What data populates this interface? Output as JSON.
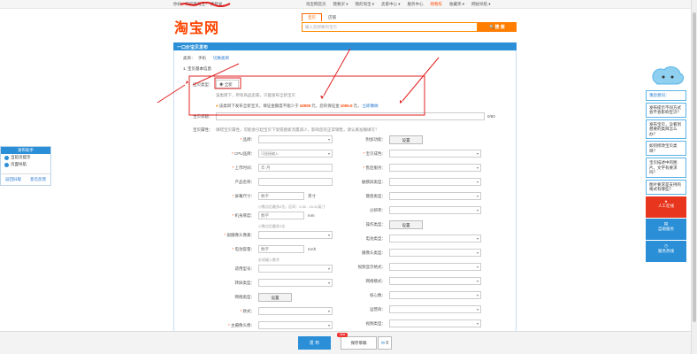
{
  "topnav": {
    "left": "你好，欢迎来淘宝！ 请登录",
    "user_links": "我的淘",
    "items": [
      "淘宝网首页",
      "我要买 ▾",
      "我的淘宝 ▾",
      "卖家中心 ▾",
      "服务中心",
      "购物车",
      "收藏夹 ▾",
      "网站导航 ▾"
    ]
  },
  "logo": "淘宝网",
  "search": {
    "tabs": [
      "宝贝",
      "店铺"
    ],
    "placeholder": "输入您想要的宝贝",
    "button": "搜 索"
  },
  "page_title": "一口价宝贝发布",
  "category": {
    "label": "类目：",
    "value": "手机",
    "change": "切换类目"
  },
  "section_title": "1. 宝贝基本信息",
  "item_type": {
    "label": "宝贝类型：",
    "option": "全新",
    "note": "该类目下，所有商品卖家，只能发布全新宝贝",
    "deposit_note": "该类目下发布全新宝贝，保证金额度不能少于",
    "amount": "10000",
    "unit": "元，您的保证金",
    "balance": "1000.0",
    "unit2": "元，",
    "link": "立即缴纳"
  },
  "title_field": {
    "label": "宝贝标题：",
    "counter": "0/60"
  },
  "props": {
    "label": "宝贝属性：",
    "hint": "填错宝贝属性，可能会引起宝贝下架或搜索流量减少，影响您的正常销售，请认真准确填写！",
    "left": [
      {
        "label": "品牌：",
        "type": "select",
        "value": "",
        "req": true
      },
      {
        "label": "CPU品牌：",
        "type": "select",
        "value": "可直接输入",
        "req": true
      },
      {
        "label": "上市时间：",
        "type": "input",
        "value": "年-月",
        "req": true
      },
      {
        "label": "产品名称：",
        "type": "input",
        "value": "",
        "req": false
      },
      {
        "label": "屏幕尺寸：",
        "type": "input",
        "value": "数字",
        "unit": "英寸",
        "sub": "小数点后最多2位，区间：0.30 - 10.00英寸",
        "req": true
      },
      {
        "label": "机身厚度：",
        "type": "input",
        "value": "数字",
        "unit": "mm",
        "sub": "小数点后最多2位",
        "req": true
      },
      {
        "label": "副摄像头像素：",
        "type": "select",
        "value": "",
        "req": true
      },
      {
        "label": "电池容量：",
        "type": "input",
        "value": "数字",
        "unit": "mAh",
        "sub": "必须输入数字",
        "req": true
      },
      {
        "label": "适用型号：",
        "type": "select",
        "value": "",
        "req": false
      },
      {
        "label": "转屏类型：",
        "type": "select",
        "value": "",
        "req": false
      },
      {
        "label": "网络类型：",
        "type": "button",
        "value": "设置",
        "req": false
      },
      {
        "label": "款式：",
        "type": "select",
        "value": "",
        "req": true
      },
      {
        "label": "主摄像头像：",
        "type": "select",
        "value": "",
        "req": true
      }
    ],
    "right": [
      {
        "label": "附加功能：",
        "type": "button",
        "value": "设置"
      },
      {
        "label": "宝贝成色：",
        "type": "select",
        "value": "",
        "req": true
      },
      {
        "label": "售后服务：",
        "type": "select",
        "value": "",
        "req": true
      },
      {
        "label": "触摸屏类型：",
        "type": "select",
        "value": ""
      },
      {
        "label": "键盘类型：",
        "type": "select",
        "value": ""
      },
      {
        "label": "分辨率：",
        "type": "select",
        "value": ""
      },
      {
        "label": "操作类型：",
        "type": "button",
        "value": "设置"
      },
      {
        "label": "电池类型：",
        "type": "select",
        "value": ""
      },
      {
        "label": "摄像头类型：",
        "type": "select",
        "value": ""
      },
      {
        "label": "视频显示格式：",
        "type": "select",
        "value": ""
      },
      {
        "label": "网络模式：",
        "type": "select",
        "value": ""
      },
      {
        "label": "核心数：",
        "type": "select",
        "value": ""
      },
      {
        "label": "运营商：",
        "type": "select",
        "value": ""
      },
      {
        "label": "视频类型：",
        "type": "select",
        "value": ""
      }
    ]
  },
  "helper": {
    "title": "发布助手",
    "items": [
      "当前页提示",
      "页面导航"
    ],
    "footer": [
      "返回旧版",
      "意见反馈"
    ]
  },
  "right_panel": {
    "faq_title": "猜您想问：",
    "faqs": [
      "发布提示不同方式会不会影响宝贝？",
      "发布宝贝，没看到想要的类目怎么办？",
      "如何修改宝贝类目？",
      "宝贝描述中的图片，文字有要求吗？",
      "图片要求是支持的格式有哪些？"
    ],
    "buttons": [
      "人工在线",
      "自助服务",
      "服务热线"
    ]
  },
  "bottom": {
    "publish": "发 布",
    "draft": "保存草稿",
    "new_tag": "new",
    "mail_count": "0"
  },
  "colors": {
    "brand": "#FF4400",
    "blue": "#2B8FD8",
    "annotation": "#E02020"
  }
}
